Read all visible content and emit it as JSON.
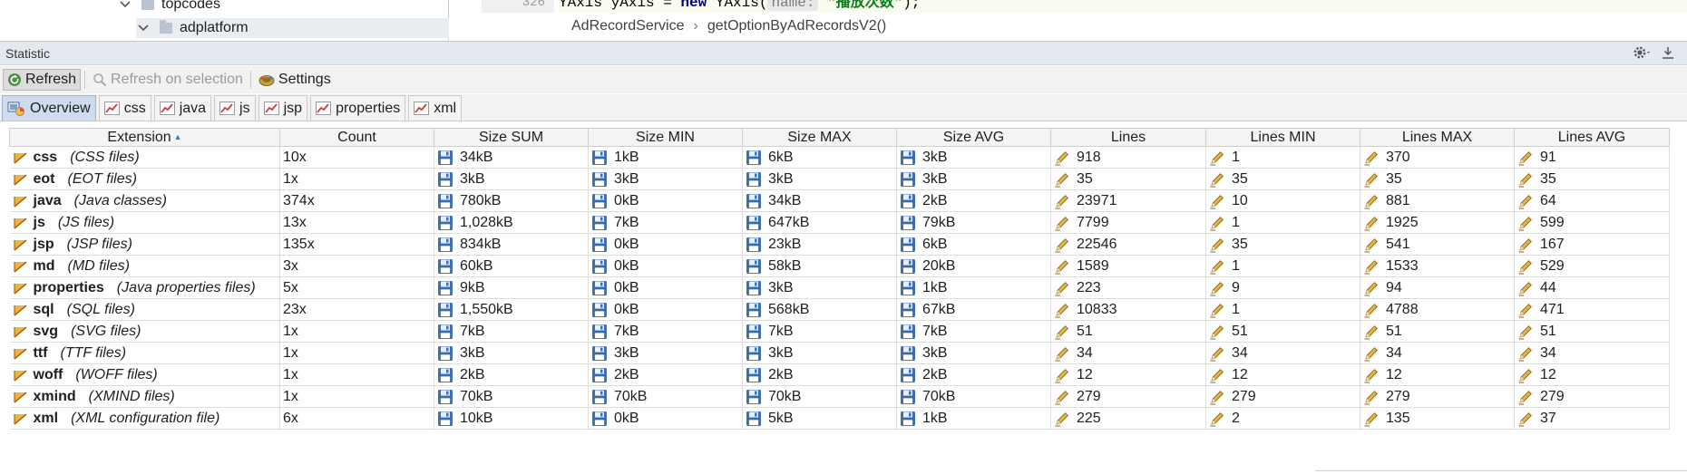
{
  "project_tree": {
    "items": [
      {
        "label": "topcodes"
      },
      {
        "label": "adplatform"
      }
    ]
  },
  "editor": {
    "gutter_line": "326",
    "code": {
      "before": "YAxis yAxis = ",
      "keyword": "new",
      "type": " YAxis(",
      "hint": "name:",
      "string": " \"播放次数\"",
      "after": ");"
    },
    "breadcrumb": [
      "AdRecordService",
      "getOptionByAdRecordsV2()"
    ],
    "breadcrumb_separator": "›"
  },
  "tool_window": {
    "title": "Statistic",
    "actions": [
      {
        "icon": "gear-icon",
        "label": ""
      },
      {
        "icon": "hide-icon",
        "label": ""
      }
    ]
  },
  "toolbar": {
    "refresh": "Refresh",
    "refresh_on_selection": "Refresh on selection",
    "settings": "Settings"
  },
  "tabs": [
    {
      "label": "Overview",
      "icon": "overview-icon",
      "active": true
    },
    {
      "label": "css",
      "icon": "chart-icon",
      "active": false
    },
    {
      "label": "java",
      "icon": "chart-icon",
      "active": false
    },
    {
      "label": "js",
      "icon": "chart-icon",
      "active": false
    },
    {
      "label": "jsp",
      "icon": "chart-icon",
      "active": false
    },
    {
      "label": "properties",
      "icon": "chart-icon",
      "active": false
    },
    {
      "label": "xml",
      "icon": "chart-icon",
      "active": false
    }
  ],
  "table": {
    "sort_indicator": "▲",
    "columns": [
      "Extension",
      "Count",
      "Size SUM",
      "Size MIN",
      "Size MAX",
      "Size AVG",
      "Lines",
      "Lines MIN",
      "Lines MAX",
      "Lines AVG"
    ],
    "rows": [
      {
        "ext": "css",
        "desc": "(CSS files)",
        "count": "10x",
        "size_sum": "34kB",
        "size_min": "1kB",
        "size_max": "6kB",
        "size_avg": "3kB",
        "lines": "918",
        "lines_min": "1",
        "lines_max": "370",
        "lines_avg": "91"
      },
      {
        "ext": "eot",
        "desc": "(EOT files)",
        "count": "1x",
        "size_sum": "3kB",
        "size_min": "3kB",
        "size_max": "3kB",
        "size_avg": "3kB",
        "lines": "35",
        "lines_min": "35",
        "lines_max": "35",
        "lines_avg": "35"
      },
      {
        "ext": "java",
        "desc": "(Java classes)",
        "count": "374x",
        "size_sum": "780kB",
        "size_min": "0kB",
        "size_max": "34kB",
        "size_avg": "2kB",
        "lines": "23971",
        "lines_min": "10",
        "lines_max": "881",
        "lines_avg": "64"
      },
      {
        "ext": "js",
        "desc": "(JS files)",
        "count": "13x",
        "size_sum": "1,028kB",
        "size_min": "7kB",
        "size_max": "647kB",
        "size_avg": "79kB",
        "lines": "7799",
        "lines_min": "1",
        "lines_max": "1925",
        "lines_avg": "599"
      },
      {
        "ext": "jsp",
        "desc": "(JSP files)",
        "count": "135x",
        "size_sum": "834kB",
        "size_min": "0kB",
        "size_max": "23kB",
        "size_avg": "6kB",
        "lines": "22546",
        "lines_min": "35",
        "lines_max": "541",
        "lines_avg": "167"
      },
      {
        "ext": "md",
        "desc": "(MD files)",
        "count": "3x",
        "size_sum": "60kB",
        "size_min": "0kB",
        "size_max": "58kB",
        "size_avg": "20kB",
        "lines": "1589",
        "lines_min": "1",
        "lines_max": "1533",
        "lines_avg": "529"
      },
      {
        "ext": "properties",
        "desc": "(Java properties files)",
        "count": "5x",
        "size_sum": "9kB",
        "size_min": "0kB",
        "size_max": "3kB",
        "size_avg": "1kB",
        "lines": "223",
        "lines_min": "9",
        "lines_max": "94",
        "lines_avg": "44"
      },
      {
        "ext": "sql",
        "desc": "(SQL files)",
        "count": "23x",
        "size_sum": "1,550kB",
        "size_min": "0kB",
        "size_max": "568kB",
        "size_avg": "67kB",
        "lines": "10833",
        "lines_min": "1",
        "lines_max": "4788",
        "lines_avg": "471"
      },
      {
        "ext": "svg",
        "desc": "(SVG files)",
        "count": "1x",
        "size_sum": "7kB",
        "size_min": "7kB",
        "size_max": "7kB",
        "size_avg": "7kB",
        "lines": "51",
        "lines_min": "51",
        "lines_max": "51",
        "lines_avg": "51"
      },
      {
        "ext": "ttf",
        "desc": "(TTF files)",
        "count": "1x",
        "size_sum": "3kB",
        "size_min": "3kB",
        "size_max": "3kB",
        "size_avg": "3kB",
        "lines": "34",
        "lines_min": "34",
        "lines_max": "34",
        "lines_avg": "34"
      },
      {
        "ext": "woff",
        "desc": "(WOFF files)",
        "count": "1x",
        "size_sum": "2kB",
        "size_min": "2kB",
        "size_max": "2kB",
        "size_avg": "2kB",
        "lines": "12",
        "lines_min": "12",
        "lines_max": "12",
        "lines_avg": "12"
      },
      {
        "ext": "xmind",
        "desc": "(XMIND files)",
        "count": "1x",
        "size_sum": "70kB",
        "size_min": "70kB",
        "size_max": "70kB",
        "size_avg": "70kB",
        "lines": "279",
        "lines_min": "279",
        "lines_max": "279",
        "lines_avg": "279"
      },
      {
        "ext": "xml",
        "desc": "(XML configuration file)",
        "count": "6x",
        "size_sum": "10kB",
        "size_min": "0kB",
        "size_max": "5kB",
        "size_avg": "1kB",
        "lines": "225",
        "lines_min": "2",
        "lines_max": "135",
        "lines_avg": "37"
      }
    ]
  },
  "colors": {
    "header_bg": "#e4e9f0",
    "active_tab": "#cfdcef",
    "file_icon": "#e8a33d",
    "disk_icon": "#3d6fb0",
    "pencil_icon": "#d9a63a"
  }
}
